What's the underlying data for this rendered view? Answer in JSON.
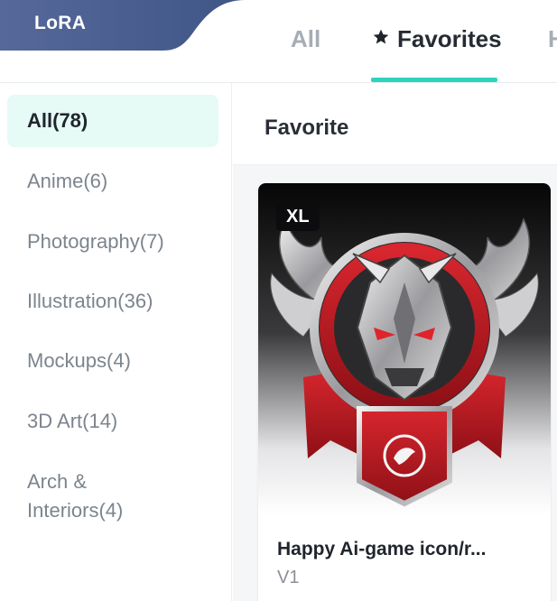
{
  "header": {
    "brand": "LoRA",
    "tabs": [
      {
        "label": "All",
        "active": false
      },
      {
        "label": "Favorites",
        "active": true
      },
      {
        "label": "H",
        "active": false
      }
    ]
  },
  "sidebar": {
    "categories": [
      {
        "label": "All(78)",
        "active": true
      },
      {
        "label": "Anime(6)"
      },
      {
        "label": "Photography(7)"
      },
      {
        "label": "Illustration(36)"
      },
      {
        "label": "Mockups(4)"
      },
      {
        "label": "3D Art(14)"
      },
      {
        "label": "Arch & Interiors(4)"
      }
    ]
  },
  "main": {
    "title": "Favorite",
    "cards": [
      {
        "badge": "XL",
        "title": "Happy Ai-game icon/r...",
        "version": "V1",
        "image": "winged silver dragon emblem with red banners"
      }
    ]
  },
  "colors": {
    "accent": "#2fd3bd",
    "active_bg": "#e6faf6",
    "brand_bg": "#4c6494"
  }
}
